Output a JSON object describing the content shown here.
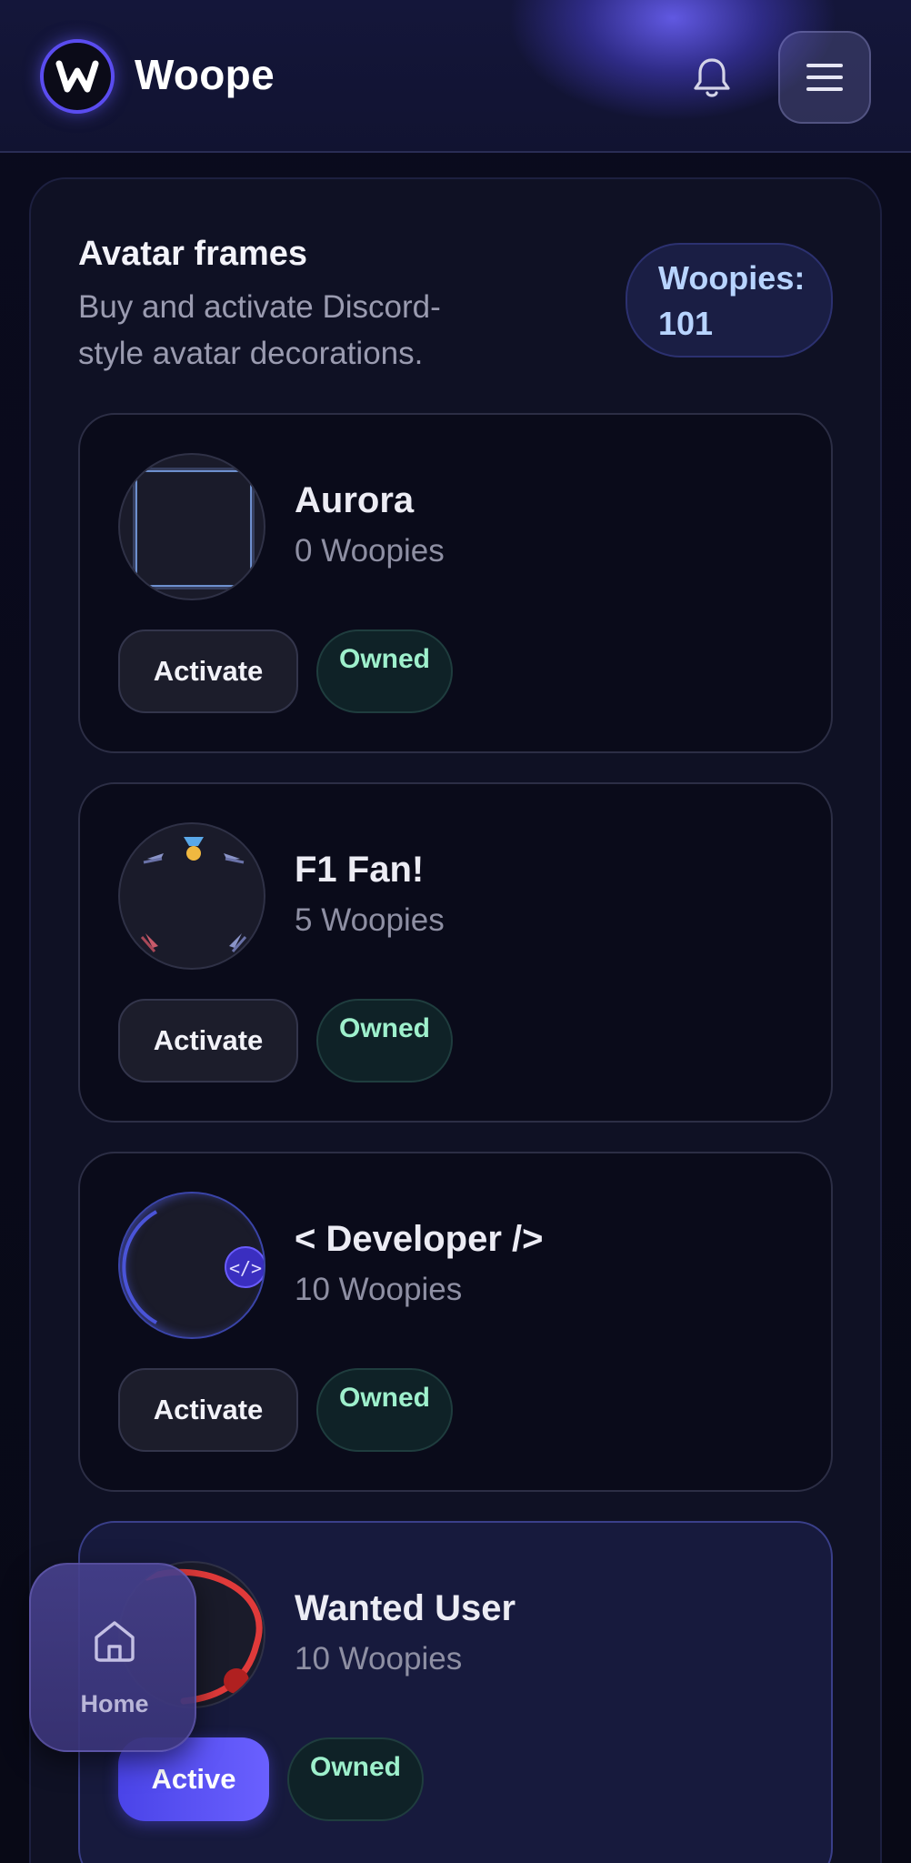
{
  "header": {
    "brand": "Woope",
    "logo_letter": "W",
    "icons": [
      "bell-icon",
      "menu-icon"
    ]
  },
  "page": {
    "title": "Avatar frames",
    "subtitle": "Buy and activate Discord-style avatar decorations.",
    "woopies_label": "Woopies:",
    "woopies_value": "101"
  },
  "frames": [
    {
      "name": "Aurora",
      "price": "0 Woopies",
      "action": "Activate",
      "status": "Owned"
    },
    {
      "name": "F1 Fan!",
      "price": "5 Woopies",
      "action": "Activate",
      "status": "Owned"
    },
    {
      "name": "< Developer />",
      "price": "10 Woopies",
      "action": "Activate",
      "status": "Owned",
      "badge_text": "</>"
    },
    {
      "name": "Wanted User",
      "price": "10 Woopies",
      "action": "Active",
      "status": "Owned"
    }
  ],
  "nav": {
    "home_label": "Home"
  },
  "colors": {
    "accent": "#5a4cf0",
    "owned_text": "#9ef0cc",
    "woopies_text": "#b8d4ff",
    "active_button": "#5850f5"
  }
}
